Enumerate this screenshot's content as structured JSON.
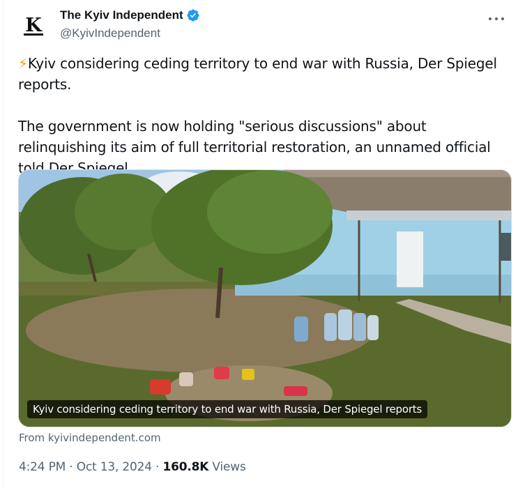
{
  "author": {
    "display_name": "The Kyiv Independent",
    "handle": "@KyivIndependent",
    "avatar_letter": "K",
    "verified_color": "#1d9bf0"
  },
  "tweet": {
    "bolt_icon": "⚡",
    "paragraph1": "Kyiv considering ceding territory to end war with Russia, Der Spiegel reports.",
    "paragraph2": "The government is now holding \"serious discussions\" about relinquishing its aim of full territorial restoration, an unnamed official told Der Spiegel."
  },
  "card": {
    "caption": "Kyiv considering ceding territory to end war with Russia, Der Spiegel reports",
    "source": "From kyivindependent.com"
  },
  "meta": {
    "time": "4:24 PM",
    "separator": " · ",
    "date": "Oct 13, 2024",
    "views_count": "160.8K",
    "views_label": " Views"
  },
  "icons": {
    "more": "more-dots-icon",
    "verified": "verified-badge-icon",
    "bolt": "lightning-bolt-icon"
  }
}
